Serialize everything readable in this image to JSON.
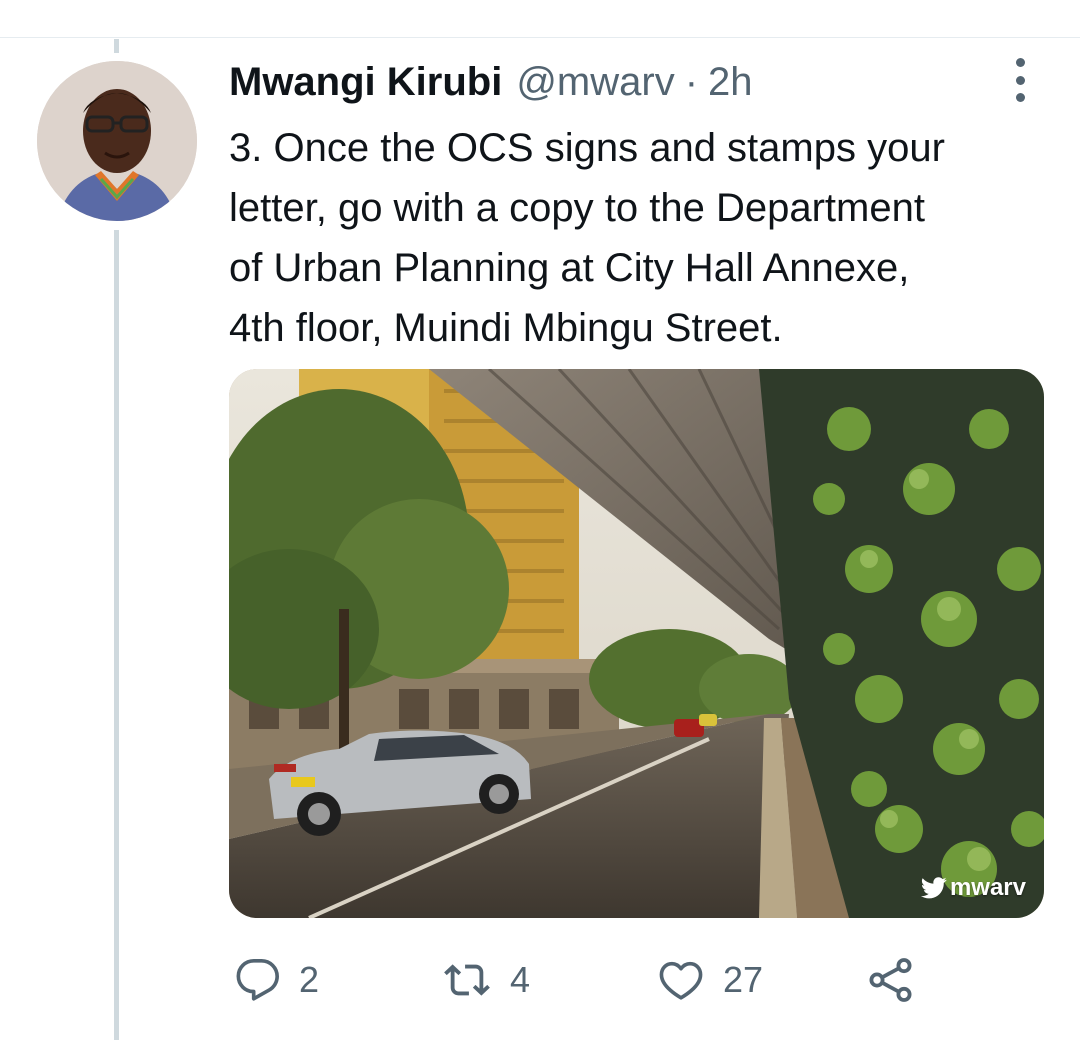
{
  "tweet": {
    "author_name": "Mwangi Kirubi",
    "handle": "@mwarv",
    "separator": "·",
    "time": "2h",
    "text_lines": [
      "3. Once the OCS signs and stamps your",
      "letter, go with a copy to the Department",
      "of Urban Planning at City Hall Annexe,",
      "4th floor, Muindi Mbingu Street."
    ],
    "media": {
      "watermark": "mwarv",
      "watermark_icon": "twitter-bird-icon"
    }
  },
  "actions": {
    "reply": {
      "icon": "reply-icon",
      "count": "2"
    },
    "retweet": {
      "icon": "retweet-icon",
      "count": "4"
    },
    "like": {
      "icon": "heart-icon",
      "count": "27"
    },
    "share": {
      "icon": "share-icon"
    }
  },
  "colors": {
    "text_primary": "#0f1419",
    "text_secondary": "#536471",
    "thread_line": "#cfd9de",
    "divider": "#e6ecf0"
  }
}
